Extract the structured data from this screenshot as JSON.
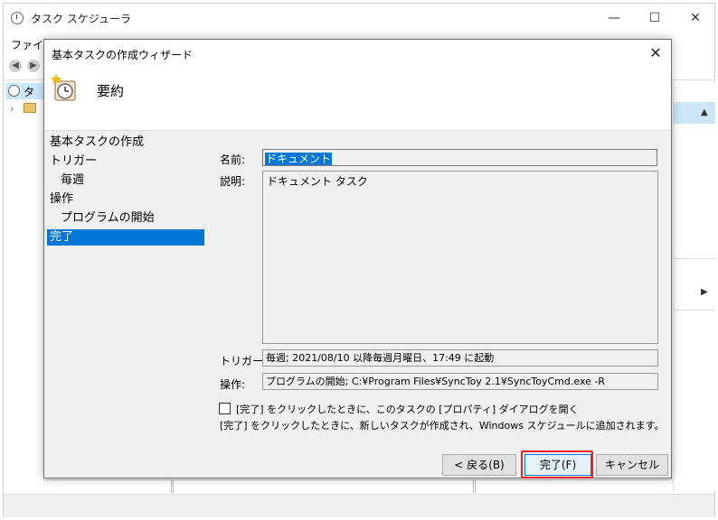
{
  "background_window": {
    "title": "タスク スケジューラ",
    "menu_file": "ファイル",
    "tree_root_label": "タス",
    "controls": {
      "minimize": "—",
      "maximize": "☐",
      "close": "✕"
    }
  },
  "dialog": {
    "title": "基本タスクの作成ウィザード",
    "close_glyph": "✕",
    "header_title": "要約",
    "steps": [
      {
        "label": "基本タスクの作成"
      },
      {
        "label": "トリガー"
      },
      {
        "label": "毎週"
      },
      {
        "label": "操作"
      },
      {
        "label": "プログラムの開始"
      },
      {
        "label": "完了"
      }
    ],
    "name_label": "名前:",
    "name_value": "ドキュメント",
    "description_label": "説明:",
    "description_value": "ドキュメント タスク",
    "trigger_label": "トリガー:",
    "trigger_value": "毎週; 2021/08/10 以降毎週月曜日、17:49 に起動",
    "action_label": "操作:",
    "action_value": "プログラムの開始; C:¥Program Files¥SyncToy 2.1¥SyncToyCmd.exe -R",
    "checkbox_label": "[完了] をクリックしたときに、このタスクの [プロパティ] ダイアログを開く",
    "info_text": "[完了] をクリックしたときに、新しいタスクが作成され、Windows スケジュールに追加されます。",
    "buttons": {
      "back": "< 戻る(B)",
      "finish": "完了(F)",
      "cancel": "キャンセル"
    }
  },
  "colors": {
    "selection": "#0078d7",
    "highlight_box": "#e8212b"
  }
}
